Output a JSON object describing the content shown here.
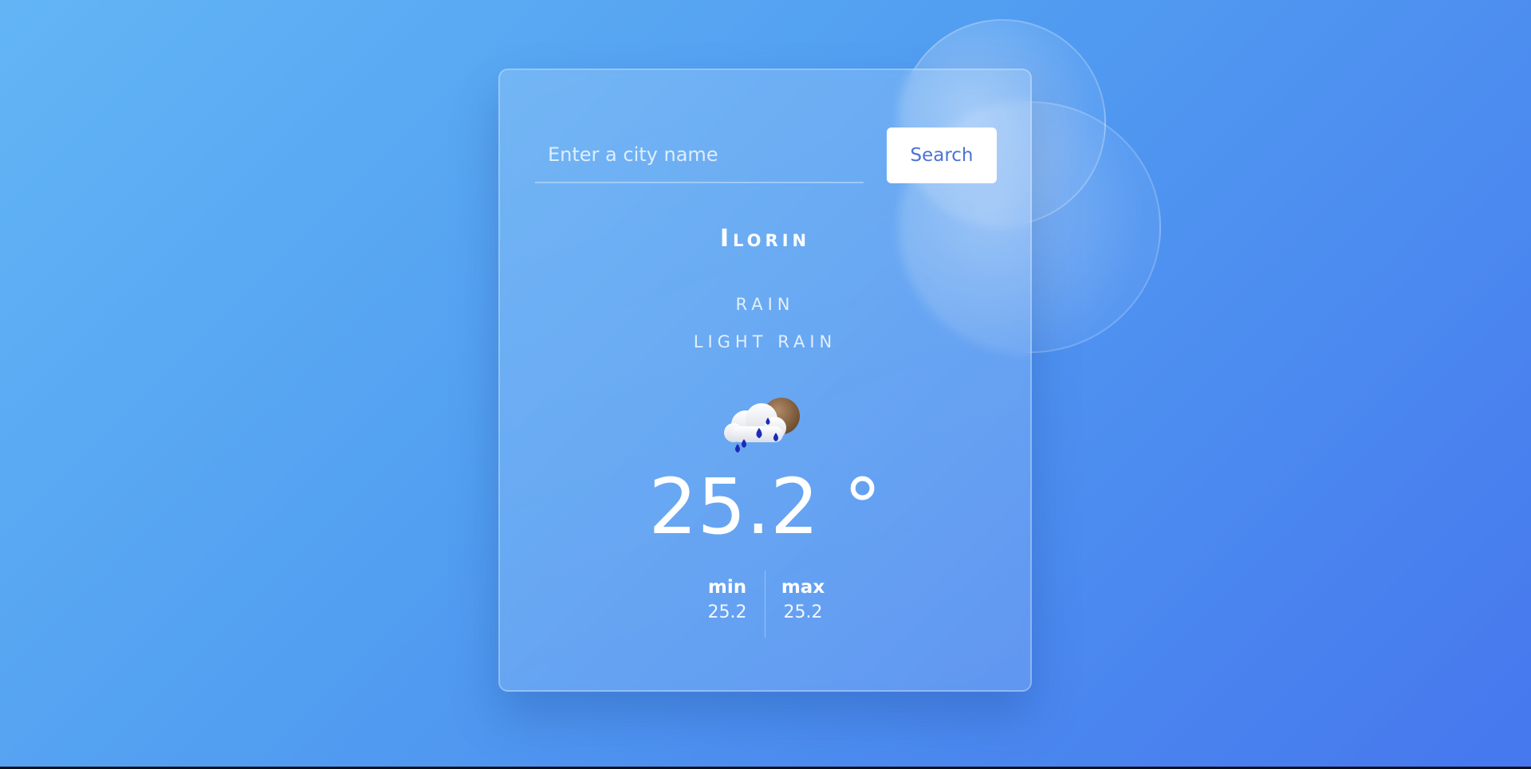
{
  "search": {
    "placeholder": "Enter a city name",
    "button_label": "Search"
  },
  "weather": {
    "city": "Ilorin",
    "main": "RAIN",
    "description": "LIGHT RAIN",
    "icon": "rain-cloud-sun-icon",
    "temperature": "25.2 °",
    "min_label": "min",
    "min_value": "25.2",
    "max_label": "max",
    "max_value": "25.2"
  },
  "colors": {
    "background_start": "#62b5f5",
    "background_end": "#4677ee",
    "button_text": "#4a73d6"
  }
}
